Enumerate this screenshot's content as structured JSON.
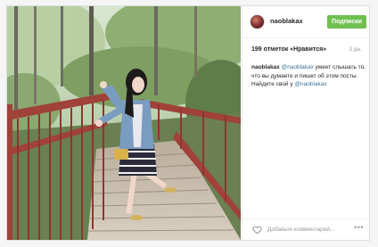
{
  "post": {
    "photo_alt": "",
    "author": {
      "username": "naoblakax"
    },
    "follow_label": "Подписки",
    "likes_text": "199 отметок «Нравится»",
    "time_ago": "3 дн.",
    "caption": {
      "author": "naoblakax",
      "mention": "@naoblakax",
      "text_1": " умеет слышать то, что вы думаете и пишет об этом посты. Найдите свой у ",
      "mention_2": "@naoblakax"
    },
    "comment_placeholder": "Добавьте комментарий...",
    "more_label": "•••",
    "colors": {
      "follow_bg": "#70c050",
      "mention": "#3f729b",
      "stairs": "#a0413a"
    },
    "icons": [
      "heart-icon",
      "more-icon"
    ]
  }
}
